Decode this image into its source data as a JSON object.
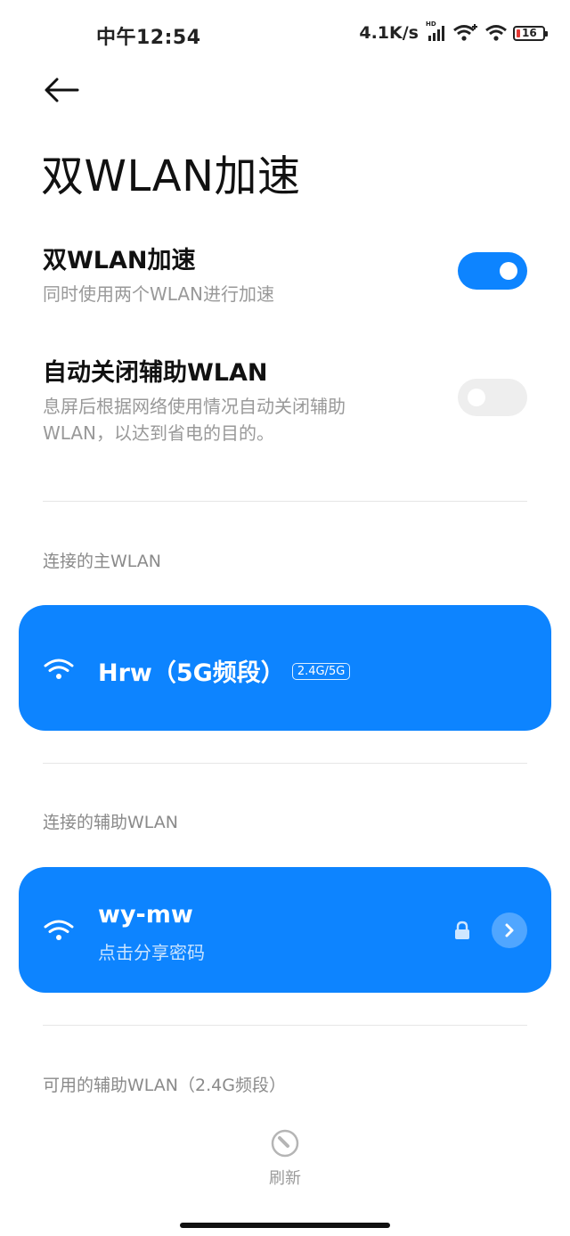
{
  "status_bar": {
    "time": "中午12:54",
    "net_speed": "4.1K/s",
    "hd_label": "HD",
    "battery_level": "16",
    "icons": [
      "signal-icon",
      "wifi-plus-icon",
      "wifi-icon",
      "battery-icon"
    ]
  },
  "page": {
    "title": "双WLAN加速"
  },
  "settings": [
    {
      "title": "双WLAN加速",
      "description": "同时使用两个WLAN进行加速",
      "enabled": true
    },
    {
      "title": "自动关闭辅助WLAN",
      "description": "息屏后根据网络使用情况自动关闭辅助WLAN，以达到省电的目的。",
      "enabled": false
    }
  ],
  "primary_section": {
    "label": "连接的主WLAN",
    "network_name": "Hrw（5G频段）",
    "band_badge": "2.4G/5G"
  },
  "secondary_section": {
    "label": "连接的辅助WLAN",
    "network_name": "wy-mw",
    "subtitle": "点击分享密码"
  },
  "available_section": {
    "label": "可用的辅助WLAN（2.4G频段）"
  },
  "refresh": {
    "label": "刷新"
  },
  "colors": {
    "accent": "#0d84ff",
    "toggle_off": "#eeeeee",
    "secondary_text": "#999999"
  }
}
